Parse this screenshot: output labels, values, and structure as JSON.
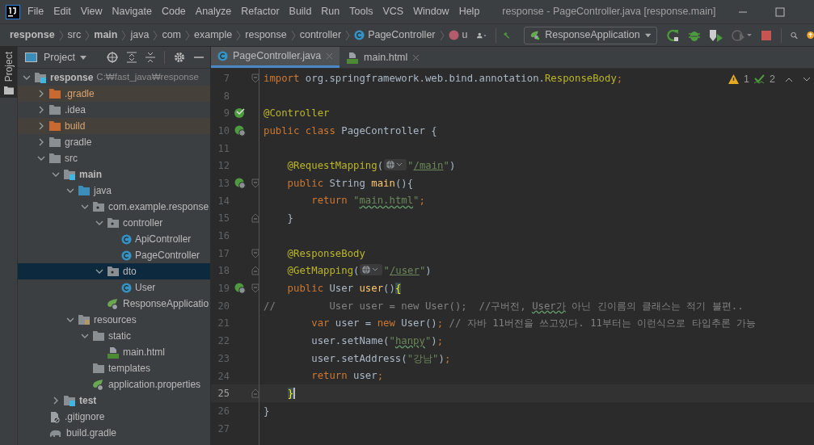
{
  "menu": [
    "File",
    "Edit",
    "View",
    "Navigate",
    "Code",
    "Analyze",
    "Refactor",
    "Build",
    "Run",
    "Tools",
    "VCS",
    "Window",
    "Help"
  ],
  "window": {
    "title": "response - PageController.java [response.main]"
  },
  "breadcrumbs": [
    {
      "label": "response",
      "bold": true
    },
    {
      "label": "src",
      "bold": false
    },
    {
      "label": "main",
      "bold": true
    },
    {
      "label": "java",
      "bold": false
    },
    {
      "label": "com",
      "bold": false
    },
    {
      "label": "example",
      "bold": false
    },
    {
      "label": "response",
      "bold": false
    },
    {
      "label": "controller",
      "bold": false
    },
    {
      "label": "PageController",
      "bold": false,
      "kind": "class"
    },
    {
      "label": "u",
      "bold": false,
      "kind": "method"
    }
  ],
  "run_configuration": "ResponseApplication",
  "side_tab": "Project",
  "project_panel": {
    "title": "Project"
  },
  "tree": [
    {
      "name": "response",
      "hint": "C:₩fast_java₩response",
      "kind": "module",
      "bold": true,
      "expanded": true,
      "selected": false,
      "children": [
        {
          "name": ".gradle",
          "kind": "excluded",
          "expanded": false,
          "selected": false
        },
        {
          "name": ".idea",
          "kind": "folder",
          "expanded": false,
          "selected": false
        },
        {
          "name": "build",
          "kind": "excluded",
          "expanded": false,
          "selected": false
        },
        {
          "name": "gradle",
          "kind": "folder",
          "expanded": false,
          "selected": false
        },
        {
          "name": "src",
          "kind": "folder",
          "expanded": true,
          "selected": false,
          "children": [
            {
              "name": "main",
              "kind": "module",
              "bold": true,
              "expanded": true,
              "selected": false,
              "children": [
                {
                  "name": "java",
                  "kind": "source",
                  "expanded": true,
                  "selected": false,
                  "children": [
                    {
                      "name": "com.example.response",
                      "kind": "package",
                      "expanded": true,
                      "selected": false,
                      "children": [
                        {
                          "name": "controller",
                          "kind": "package",
                          "expanded": true,
                          "selected": false,
                          "children": [
                            {
                              "name": "ApiController",
                              "kind": "class",
                              "selected": false
                            },
                            {
                              "name": "PageController",
                              "kind": "class",
                              "selected": false
                            }
                          ]
                        },
                        {
                          "name": "dto",
                          "kind": "package",
                          "expanded": true,
                          "selected": true,
                          "children": [
                            {
                              "name": "User",
                              "kind": "class",
                              "selected": false
                            }
                          ]
                        },
                        {
                          "name": "ResponseApplicatio",
                          "kind": "spring",
                          "selected": false
                        }
                      ]
                    }
                  ]
                },
                {
                  "name": "resources",
                  "kind": "resources",
                  "expanded": true,
                  "selected": false,
                  "children": [
                    {
                      "name": "static",
                      "kind": "folder",
                      "expanded": true,
                      "selected": false,
                      "children": [
                        {
                          "name": "main.html",
                          "kind": "html",
                          "selected": false
                        }
                      ]
                    },
                    {
                      "name": "templates",
                      "kind": "folder",
                      "selected": false
                    },
                    {
                      "name": "application.properties",
                      "kind": "spring",
                      "selected": false
                    }
                  ]
                }
              ]
            },
            {
              "name": "test",
              "kind": "module",
              "bold": true,
              "expanded": false,
              "selected": false
            }
          ]
        },
        {
          "name": ".gitignore",
          "kind": "ignore",
          "selected": false
        },
        {
          "name": "build.gradle",
          "kind": "gradle",
          "selected": false
        }
      ]
    }
  ],
  "tabs": [
    {
      "label": "PageController.java",
      "kind": "class",
      "selected": true
    },
    {
      "label": "main.html",
      "kind": "html",
      "selected": false
    }
  ],
  "inspections": {
    "warnings": "1",
    "typos": "2"
  },
  "lines": [
    {
      "number": "7",
      "fold": {
        "kind": "start"
      },
      "tokens": [
        {
          "kind": "keyword",
          "text": "import"
        },
        {
          "kind": "plain",
          "text": " org.springframework.web.bind.annotation."
        },
        {
          "kind": "annotation",
          "text": "ResponseBody"
        },
        {
          "kind": "keyword",
          "text": ";"
        }
      ]
    },
    {
      "number": "8"
    },
    {
      "number": "9",
      "gutter": {
        "kind": "bean"
      },
      "tokens": [
        {
          "kind": "annotation",
          "text": "@Controller"
        }
      ]
    },
    {
      "number": "10",
      "gutter": {
        "kind": "web"
      },
      "tokens": [
        {
          "kind": "keyword",
          "text": "public class "
        },
        {
          "kind": "plain",
          "text": "PageController {"
        }
      ]
    },
    {
      "number": "11"
    },
    {
      "number": "12",
      "tokens": [
        {
          "kind": "annotation",
          "text": "    @RequestMapping"
        },
        {
          "kind": "plain",
          "text": "("
        },
        {
          "kind": "inlay"
        },
        {
          "kind": "string",
          "text": "\""
        },
        {
          "kind": "url",
          "text": "/main"
        },
        {
          "kind": "string",
          "text": "\""
        },
        {
          "kind": "plain",
          "text": ")"
        }
      ]
    },
    {
      "number": "13",
      "gutter": {
        "kind": "web"
      },
      "fold": {
        "kind": "start"
      },
      "tokens": [
        {
          "kind": "keyword",
          "text": "    public "
        },
        {
          "kind": "plain",
          "text": "String "
        },
        {
          "kind": "method",
          "text": "main"
        },
        {
          "kind": "plain",
          "text": "(){"
        }
      ]
    },
    {
      "number": "14",
      "tokens": [
        {
          "kind": "keyword",
          "text": "        return "
        },
        {
          "kind": "string",
          "text": "\""
        },
        {
          "kind": "string",
          "text": "main.html",
          "typo": true
        },
        {
          "kind": "string",
          "text": "\""
        },
        {
          "kind": "keyword",
          "text": ";"
        }
      ]
    },
    {
      "number": "15",
      "fold": {
        "kind": "end"
      },
      "tokens": [
        {
          "kind": "plain",
          "text": "    }"
        }
      ]
    },
    {
      "number": "16"
    },
    {
      "number": "17",
      "fold": {
        "kind": "start"
      },
      "tokens": [
        {
          "kind": "annotation",
          "text": "    @ResponseBody"
        }
      ]
    },
    {
      "number": "18",
      "fold": {
        "kind": "end"
      },
      "tokens": [
        {
          "kind": "annotation",
          "text": "    @GetMapping"
        },
        {
          "kind": "plain",
          "text": "("
        },
        {
          "kind": "inlay"
        },
        {
          "kind": "string",
          "text": "\""
        },
        {
          "kind": "url",
          "text": "/user"
        },
        {
          "kind": "string",
          "text": "\""
        },
        {
          "kind": "plain",
          "text": ")"
        }
      ]
    },
    {
      "number": "19",
      "gutter": {
        "kind": "web"
      },
      "fold": {
        "kind": "start"
      },
      "tokens": [
        {
          "kind": "keyword",
          "text": "    public "
        },
        {
          "kind": "plain",
          "text": "User "
        },
        {
          "kind": "method",
          "text": "user"
        },
        {
          "kind": "plain",
          "text": "()"
        },
        {
          "kind": "brace",
          "text": "{"
        }
      ]
    },
    {
      "number": "20",
      "tokens": [
        {
          "kind": "comment",
          "text": "//         User user = new User();  //구버전, "
        },
        {
          "kind": "comment",
          "text": "User가",
          "typo": true
        },
        {
          "kind": "comment",
          "text": " 아닌 긴이름의 클래스는 적기 불편.."
        }
      ]
    },
    {
      "number": "21",
      "tokens": [
        {
          "kind": "keyword",
          "text": "        var "
        },
        {
          "kind": "plain",
          "text": "user = "
        },
        {
          "kind": "keyword",
          "text": "new "
        },
        {
          "kind": "plain",
          "text": "User()"
        },
        {
          "kind": "keyword",
          "text": ";"
        },
        {
          "kind": "comment",
          "text": " // 자바 11버전을 쓰고있다. 11부터는 이런식으로 타입추론 가능"
        }
      ]
    },
    {
      "number": "22",
      "tokens": [
        {
          "kind": "plain",
          "text": "        user.setName("
        },
        {
          "kind": "string",
          "text": "\""
        },
        {
          "kind": "string",
          "text": "hanpy",
          "typo": true
        },
        {
          "kind": "string",
          "text": "\""
        },
        {
          "kind": "plain",
          "text": ")"
        },
        {
          "kind": "keyword",
          "text": ";"
        }
      ]
    },
    {
      "number": "23",
      "tokens": [
        {
          "kind": "plain",
          "text": "        user.setAddress("
        },
        {
          "kind": "string",
          "text": "\"강남\""
        },
        {
          "kind": "plain",
          "text": ")"
        },
        {
          "kind": "keyword",
          "text": ";"
        }
      ]
    },
    {
      "number": "24",
      "tokens": [
        {
          "kind": "keyword",
          "text": "        return "
        },
        {
          "kind": "plain",
          "text": "user"
        },
        {
          "kind": "keyword",
          "text": ";"
        }
      ]
    },
    {
      "number": "25",
      "current": true,
      "fold": {
        "kind": "end"
      },
      "tokens": [
        {
          "kind": "brace",
          "text": "    }",
          "caret": true
        }
      ]
    },
    {
      "number": "26",
      "tokens": [
        {
          "kind": "plain",
          "text": "}"
        }
      ]
    },
    {
      "number": "27"
    }
  ]
}
